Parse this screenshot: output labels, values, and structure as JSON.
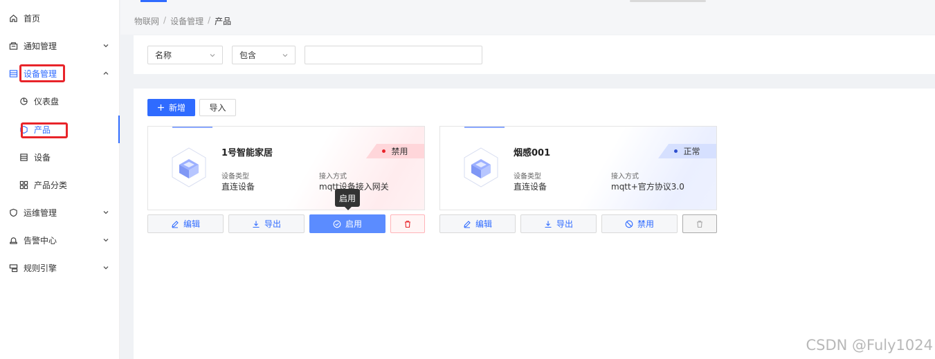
{
  "sidebar": {
    "items": [
      {
        "label": "首页",
        "icon": "home-icon"
      },
      {
        "label": "通知管理",
        "icon": "notification-icon"
      },
      {
        "label": "设备管理",
        "icon": "device-icon"
      },
      {
        "label": "仪表盘",
        "icon": "dashboard-icon"
      },
      {
        "label": "产品",
        "icon": "product-icon"
      },
      {
        "label": "设备",
        "icon": "device-list-icon"
      },
      {
        "label": "产品分类",
        "icon": "category-icon"
      },
      {
        "label": "运维管理",
        "icon": "ops-icon"
      },
      {
        "label": "告警中心",
        "icon": "alarm-icon"
      },
      {
        "label": "规则引擎",
        "icon": "rule-engine-icon"
      }
    ]
  },
  "breadcrumb": {
    "items": [
      "物联网",
      "设备管理",
      "产品"
    ],
    "separator": "/"
  },
  "filter": {
    "field": "名称",
    "operator": "包含",
    "value": ""
  },
  "toolbar": {
    "add_label": "新增",
    "import_label": "导入"
  },
  "cards": [
    {
      "name": "1号智能家居",
      "status": "禁用",
      "status_color": "#e8242a",
      "device_type_label": "设备类型",
      "device_type": "直连设备",
      "access_label": "接入方式",
      "access": "mqtt设备接入网关",
      "actions": {
        "edit": "编辑",
        "export": "导出",
        "toggle": "启用"
      }
    },
    {
      "name": "烟感001",
      "status": "正常",
      "status_color": "#2f4fcf",
      "device_type_label": "设备类型",
      "device_type": "直连设备",
      "access_label": "接入方式",
      "access": "mqtt+官方协议3.0",
      "actions": {
        "edit": "编辑",
        "export": "导出",
        "toggle": "禁用"
      }
    }
  ],
  "tooltip": "启用",
  "watermark": "CSDN @Fuly1024",
  "colors": {
    "primary": "#2f6bff",
    "highlight": "#e8242a"
  }
}
